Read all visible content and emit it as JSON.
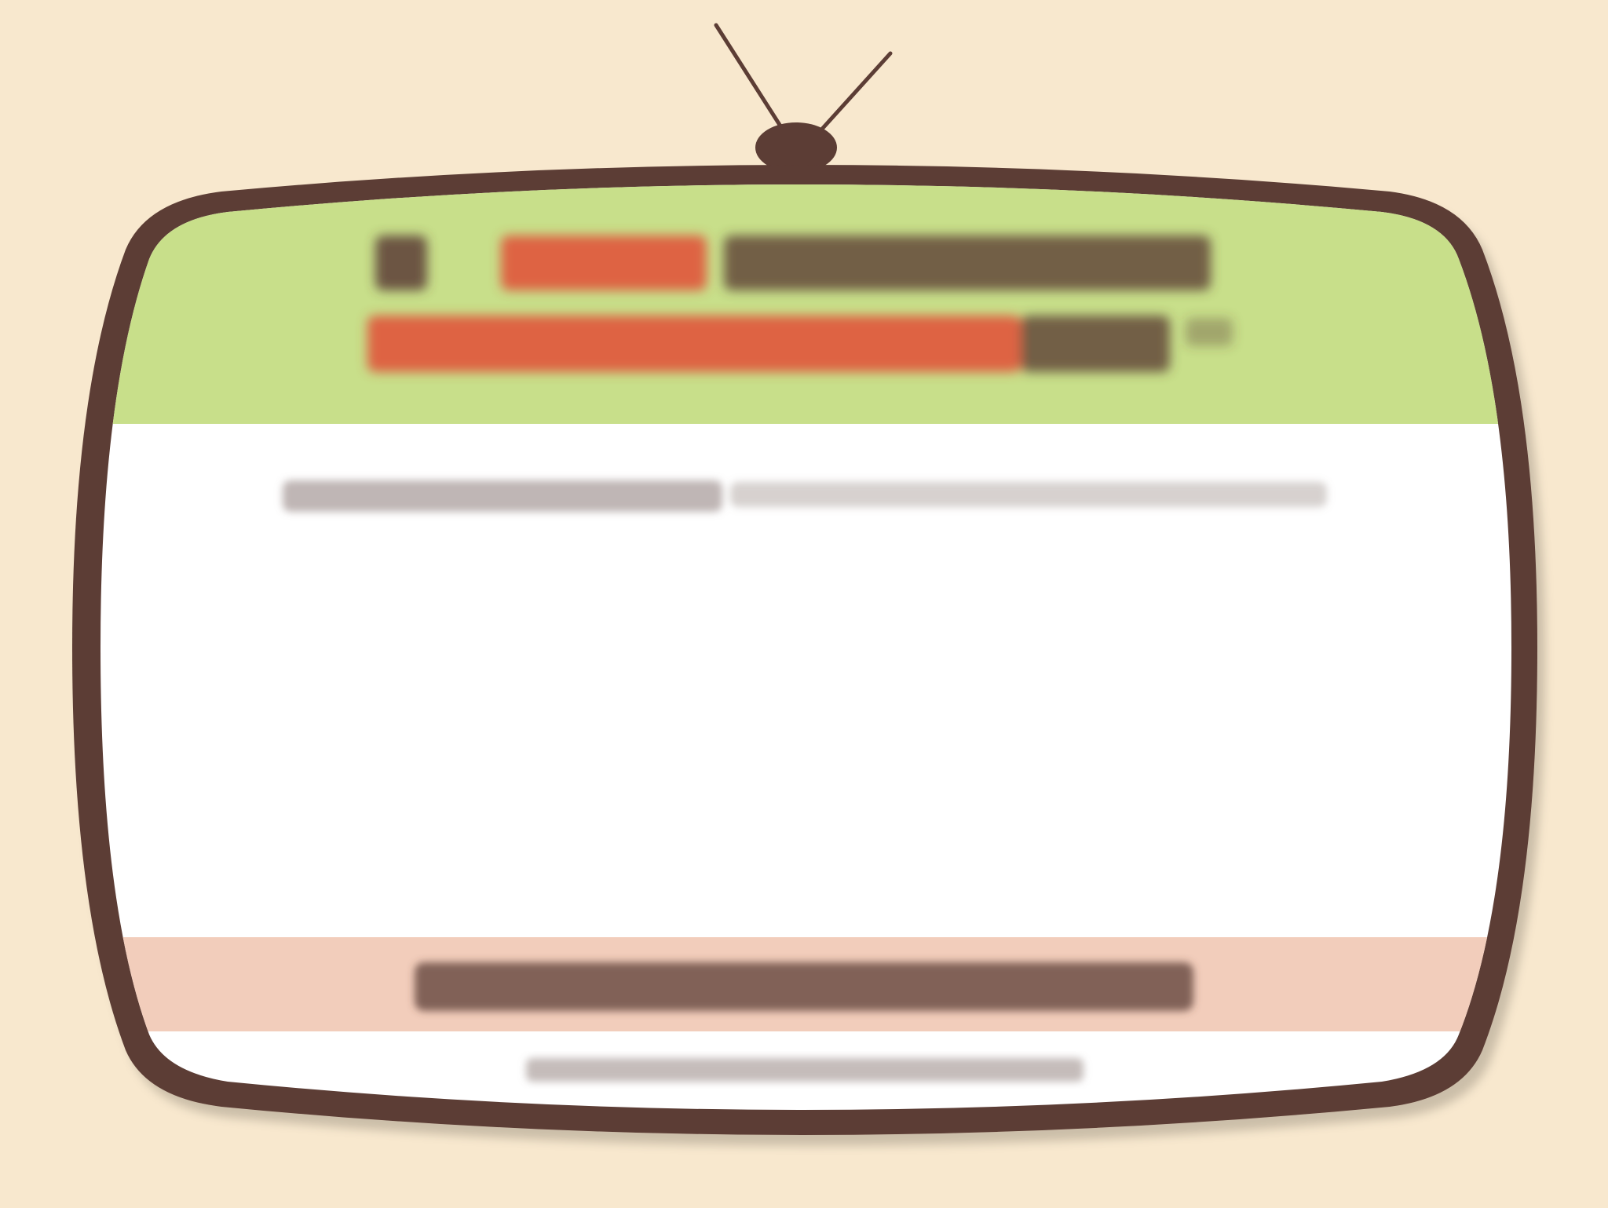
{
  "scene": {
    "description_free": true,
    "colors": {
      "background": "#f8e8ce",
      "frame": "#5c3d35",
      "header_band": "#c8df8a",
      "footer_band": "#f2cdbb",
      "screen": "#ffffff",
      "accent_text": "#e0543a",
      "dark_text": "#5c3d35"
    }
  },
  "tv": {
    "icons": {
      "antenna": "antenna-icon",
      "knob": "antenna-knob-icon"
    }
  },
  "header": {
    "line1_segments": [
      "",
      "",
      ""
    ],
    "line2_segments": [
      "",
      ""
    ]
  },
  "body": {
    "subtitle": ""
  },
  "footer": {
    "question": "",
    "caption": ""
  }
}
